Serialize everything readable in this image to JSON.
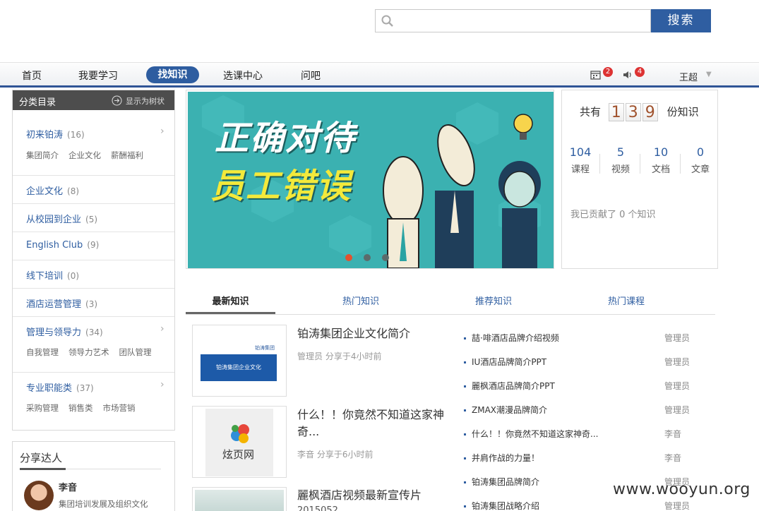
{
  "search": {
    "placeholder": "",
    "button_label": "搜索"
  },
  "nav": {
    "items": [
      "首页",
      "我要学习",
      "找知识",
      "选课中心",
      "问吧"
    ],
    "active_label": "找知识",
    "calendar_badge": "2",
    "sound_badge": "4",
    "user_name": "王超"
  },
  "sidebar": {
    "title": "分类目录",
    "tree_toggle": "显示为树状",
    "categories": [
      {
        "name": "初来铂涛",
        "count": "(16)",
        "subs": [
          "集团简介",
          "企业文化",
          "薪酬福利"
        ]
      },
      {
        "name": "企业文化",
        "count": "(8)",
        "subs": []
      },
      {
        "name": "从校园到企业",
        "count": "(5)",
        "subs": []
      },
      {
        "name": "English Club",
        "count": "(9)",
        "subs": []
      },
      {
        "name": "线下培训",
        "count": "(0)",
        "subs": []
      },
      {
        "name": "酒店运营管理",
        "count": "(3)",
        "subs": []
      },
      {
        "name": "管理与领导力",
        "count": "(34)",
        "subs": [
          "自我管理",
          "领导力艺术",
          "团队管理"
        ]
      },
      {
        "name": "专业职能类",
        "count": "(37)",
        "subs": [
          "采购管理",
          "销售类",
          "市场营销"
        ]
      }
    ]
  },
  "sharers": {
    "title": "分享达人",
    "top": {
      "name": "李音",
      "desc": "集团培训发展及组织文化"
    }
  },
  "banner": {
    "line1": "正确对待",
    "line2": "员工错误",
    "active_dot": 0,
    "dot_count": 3
  },
  "stats": {
    "prefix": "共有",
    "digits": [
      "1",
      "3",
      "9"
    ],
    "suffix": "份知识",
    "items": [
      {
        "num": "104",
        "label": "课程"
      },
      {
        "num": "5",
        "label": "视频"
      },
      {
        "num": "10",
        "label": "文档"
      },
      {
        "num": "0",
        "label": "文章"
      }
    ],
    "contrib": "我已贡献了 0 个知识"
  },
  "tabs": [
    "最新知识",
    "热门知识",
    "推荐知识",
    "热门课程"
  ],
  "knowledge": [
    {
      "title": "铂涛集团企业文化简介",
      "meta": "管理员 分享于4小时前",
      "thumb_text": "铂涛集团企业文化",
      "thumb_logo": "铂涛集团"
    },
    {
      "title": "什么！！你竟然不知道这家神奇...",
      "meta": "李音 分享于6小时前",
      "thumb_text": "炫页网"
    },
    {
      "title": "麗枫酒店视频最新宣传片",
      "meta": "2015052..."
    }
  ],
  "hot_list": [
    {
      "title": "喆·啡酒店品牌介绍视频",
      "author": "管理员"
    },
    {
      "title": "IU酒店品牌简介PPT",
      "author": "管理员"
    },
    {
      "title": "麗枫酒店品牌简介PPT",
      "author": "管理员"
    },
    {
      "title": "ZMAX潮漫品牌简介",
      "author": "管理员"
    },
    {
      "title": "什么！！你竟然不知道这家神奇...",
      "author": "李音"
    },
    {
      "title": "并肩作战的力量！",
      "author": "李音"
    },
    {
      "title": "铂涛集团品牌简介",
      "author": "管理员"
    },
    {
      "title": "铂涛集团战略介绍",
      "author": "管理员"
    }
  ],
  "watermark": "www.wooyun.org",
  "colors": {
    "accent": "#2f5ea1",
    "banner_bg": "#3bb1b1",
    "active_dot": "#e2522f"
  }
}
